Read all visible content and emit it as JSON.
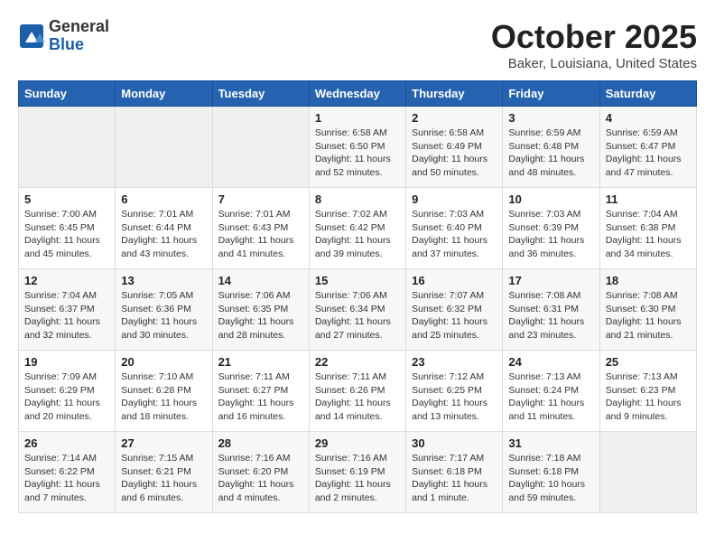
{
  "header": {
    "logo_general": "General",
    "logo_blue": "Blue",
    "month_title": "October 2025",
    "location": "Baker, Louisiana, United States"
  },
  "days_of_week": [
    "Sunday",
    "Monday",
    "Tuesday",
    "Wednesday",
    "Thursday",
    "Friday",
    "Saturday"
  ],
  "weeks": [
    [
      {
        "day": "",
        "info": ""
      },
      {
        "day": "",
        "info": ""
      },
      {
        "day": "",
        "info": ""
      },
      {
        "day": "1",
        "info": "Sunrise: 6:58 AM\nSunset: 6:50 PM\nDaylight: 11 hours\nand 52 minutes."
      },
      {
        "day": "2",
        "info": "Sunrise: 6:58 AM\nSunset: 6:49 PM\nDaylight: 11 hours\nand 50 minutes."
      },
      {
        "day": "3",
        "info": "Sunrise: 6:59 AM\nSunset: 6:48 PM\nDaylight: 11 hours\nand 48 minutes."
      },
      {
        "day": "4",
        "info": "Sunrise: 6:59 AM\nSunset: 6:47 PM\nDaylight: 11 hours\nand 47 minutes."
      }
    ],
    [
      {
        "day": "5",
        "info": "Sunrise: 7:00 AM\nSunset: 6:45 PM\nDaylight: 11 hours\nand 45 minutes."
      },
      {
        "day": "6",
        "info": "Sunrise: 7:01 AM\nSunset: 6:44 PM\nDaylight: 11 hours\nand 43 minutes."
      },
      {
        "day": "7",
        "info": "Sunrise: 7:01 AM\nSunset: 6:43 PM\nDaylight: 11 hours\nand 41 minutes."
      },
      {
        "day": "8",
        "info": "Sunrise: 7:02 AM\nSunset: 6:42 PM\nDaylight: 11 hours\nand 39 minutes."
      },
      {
        "day": "9",
        "info": "Sunrise: 7:03 AM\nSunset: 6:40 PM\nDaylight: 11 hours\nand 37 minutes."
      },
      {
        "day": "10",
        "info": "Sunrise: 7:03 AM\nSunset: 6:39 PM\nDaylight: 11 hours\nand 36 minutes."
      },
      {
        "day": "11",
        "info": "Sunrise: 7:04 AM\nSunset: 6:38 PM\nDaylight: 11 hours\nand 34 minutes."
      }
    ],
    [
      {
        "day": "12",
        "info": "Sunrise: 7:04 AM\nSunset: 6:37 PM\nDaylight: 11 hours\nand 32 minutes."
      },
      {
        "day": "13",
        "info": "Sunrise: 7:05 AM\nSunset: 6:36 PM\nDaylight: 11 hours\nand 30 minutes."
      },
      {
        "day": "14",
        "info": "Sunrise: 7:06 AM\nSunset: 6:35 PM\nDaylight: 11 hours\nand 28 minutes."
      },
      {
        "day": "15",
        "info": "Sunrise: 7:06 AM\nSunset: 6:34 PM\nDaylight: 11 hours\nand 27 minutes."
      },
      {
        "day": "16",
        "info": "Sunrise: 7:07 AM\nSunset: 6:32 PM\nDaylight: 11 hours\nand 25 minutes."
      },
      {
        "day": "17",
        "info": "Sunrise: 7:08 AM\nSunset: 6:31 PM\nDaylight: 11 hours\nand 23 minutes."
      },
      {
        "day": "18",
        "info": "Sunrise: 7:08 AM\nSunset: 6:30 PM\nDaylight: 11 hours\nand 21 minutes."
      }
    ],
    [
      {
        "day": "19",
        "info": "Sunrise: 7:09 AM\nSunset: 6:29 PM\nDaylight: 11 hours\nand 20 minutes."
      },
      {
        "day": "20",
        "info": "Sunrise: 7:10 AM\nSunset: 6:28 PM\nDaylight: 11 hours\nand 18 minutes."
      },
      {
        "day": "21",
        "info": "Sunrise: 7:11 AM\nSunset: 6:27 PM\nDaylight: 11 hours\nand 16 minutes."
      },
      {
        "day": "22",
        "info": "Sunrise: 7:11 AM\nSunset: 6:26 PM\nDaylight: 11 hours\nand 14 minutes."
      },
      {
        "day": "23",
        "info": "Sunrise: 7:12 AM\nSunset: 6:25 PM\nDaylight: 11 hours\nand 13 minutes."
      },
      {
        "day": "24",
        "info": "Sunrise: 7:13 AM\nSunset: 6:24 PM\nDaylight: 11 hours\nand 11 minutes."
      },
      {
        "day": "25",
        "info": "Sunrise: 7:13 AM\nSunset: 6:23 PM\nDaylight: 11 hours\nand 9 minutes."
      }
    ],
    [
      {
        "day": "26",
        "info": "Sunrise: 7:14 AM\nSunset: 6:22 PM\nDaylight: 11 hours\nand 7 minutes."
      },
      {
        "day": "27",
        "info": "Sunrise: 7:15 AM\nSunset: 6:21 PM\nDaylight: 11 hours\nand 6 minutes."
      },
      {
        "day": "28",
        "info": "Sunrise: 7:16 AM\nSunset: 6:20 PM\nDaylight: 11 hours\nand 4 minutes."
      },
      {
        "day": "29",
        "info": "Sunrise: 7:16 AM\nSunset: 6:19 PM\nDaylight: 11 hours\nand 2 minutes."
      },
      {
        "day": "30",
        "info": "Sunrise: 7:17 AM\nSunset: 6:18 PM\nDaylight: 11 hours\nand 1 minute."
      },
      {
        "day": "31",
        "info": "Sunrise: 7:18 AM\nSunset: 6:18 PM\nDaylight: 10 hours\nand 59 minutes."
      },
      {
        "day": "",
        "info": ""
      }
    ]
  ]
}
